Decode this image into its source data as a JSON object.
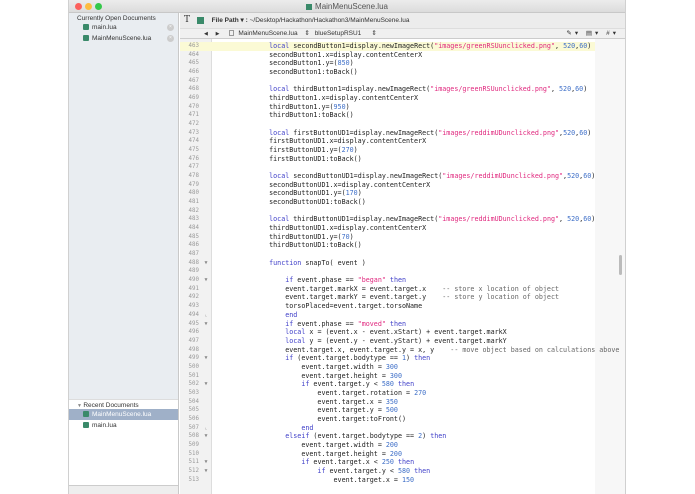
{
  "window": {
    "title": "MainMenuScene.lua"
  },
  "sidebar": {
    "open_header": "Currently Open Documents",
    "open_docs": [
      "main.lua",
      "MainMenuScene.lua"
    ],
    "recent_header": "Recent Documents",
    "recent_docs": [
      "MainMenuScene.lua",
      "main.lua"
    ]
  },
  "toolbar": {
    "file_path_label": "File Path ▾ :",
    "file_path": "~/Desktop/Hackathon/Hackathon3/MainMenuScene.lua"
  },
  "navbar": {
    "file": "MainMenuScene.lua",
    "symbol": "blueSetupRSU1"
  },
  "editor": {
    "highlight_line": 463,
    "lines": [
      {
        "n": 463,
        "f": "",
        "t": [
          [
            "",
            "    "
          ],
          [
            "kw",
            "local"
          ],
          [
            "",
            " secondButton1=display.newImageRect("
          ],
          [
            "str",
            "\"images/greenRSUunclicked.png\""
          ],
          [
            "",
            ", "
          ],
          [
            "num-lit",
            "520"
          ],
          [
            "",
            ","
          ],
          [
            "num-lit",
            "60"
          ],
          [
            "",
            ")"
          ]
        ]
      },
      {
        "n": 464,
        "f": "",
        "t": [
          [
            "",
            "    secondButton1.x=display.contentCenterX"
          ]
        ]
      },
      {
        "n": 465,
        "f": "",
        "t": [
          [
            "",
            "    secondButton1.y=("
          ],
          [
            "num-lit",
            "850"
          ],
          [
            "",
            ")"
          ]
        ]
      },
      {
        "n": 466,
        "f": "",
        "t": [
          [
            "",
            "    secondButton1:toBack()"
          ]
        ]
      },
      {
        "n": 467,
        "f": "",
        "t": []
      },
      {
        "n": 468,
        "f": "",
        "t": [
          [
            "",
            "    "
          ],
          [
            "kw",
            "local"
          ],
          [
            "",
            " thirdButton1=display.newImageRect("
          ],
          [
            "str",
            "\"images/greenRSUunclicked.png\""
          ],
          [
            "",
            ", "
          ],
          [
            "num-lit",
            "520"
          ],
          [
            "",
            ","
          ],
          [
            "num-lit",
            "60"
          ],
          [
            "",
            ")"
          ]
        ]
      },
      {
        "n": 469,
        "f": "",
        "t": [
          [
            "",
            "    thirdButton1.x=display.contentCenterX"
          ]
        ]
      },
      {
        "n": 470,
        "f": "",
        "t": [
          [
            "",
            "    thirdButton1.y=("
          ],
          [
            "num-lit",
            "950"
          ],
          [
            "",
            ")"
          ]
        ]
      },
      {
        "n": 471,
        "f": "",
        "t": [
          [
            "",
            "    thirdButton1:toBack()"
          ]
        ]
      },
      {
        "n": 472,
        "f": "",
        "t": []
      },
      {
        "n": 473,
        "f": "",
        "t": [
          [
            "",
            "    "
          ],
          [
            "kw",
            "local"
          ],
          [
            "",
            " firstButtonUD1=display.newImageRect("
          ],
          [
            "str",
            "\"images/reddimUDunclicked.png\""
          ],
          [
            "",
            ","
          ],
          [
            "num-lit",
            "520"
          ],
          [
            "",
            ","
          ],
          [
            "num-lit",
            "60"
          ],
          [
            "",
            ")"
          ]
        ]
      },
      {
        "n": 474,
        "f": "",
        "t": [
          [
            "",
            "    firstButtonUD1.x=display.contentCenterX"
          ]
        ]
      },
      {
        "n": 475,
        "f": "",
        "t": [
          [
            "",
            "    firstButtonUD1.y=("
          ],
          [
            "num-lit",
            "270"
          ],
          [
            "",
            ")"
          ]
        ]
      },
      {
        "n": 476,
        "f": "",
        "t": [
          [
            "",
            "    firstButtonUD1:toBack()"
          ]
        ]
      },
      {
        "n": 477,
        "f": "",
        "t": []
      },
      {
        "n": 478,
        "f": "",
        "t": [
          [
            "",
            "    "
          ],
          [
            "kw",
            "local"
          ],
          [
            "",
            " secondButtonUD1=display.newImageRect("
          ],
          [
            "str",
            "\"images/reddimUDunclicked.png\""
          ],
          [
            "",
            ","
          ],
          [
            "num-lit",
            "520"
          ],
          [
            "",
            ","
          ],
          [
            "num-lit",
            "60"
          ],
          [
            "",
            ")"
          ]
        ]
      },
      {
        "n": 479,
        "f": "",
        "t": [
          [
            "",
            "    secondButtonUD1.x=display.contentCenterX"
          ]
        ]
      },
      {
        "n": 480,
        "f": "",
        "t": [
          [
            "",
            "    secondButtonUD1.y=("
          ],
          [
            "num-lit",
            "170"
          ],
          [
            "",
            ")"
          ]
        ]
      },
      {
        "n": 481,
        "f": "",
        "t": [
          [
            "",
            "    secondButtonUD1:toBack()"
          ]
        ]
      },
      {
        "n": 482,
        "f": "",
        "t": []
      },
      {
        "n": 483,
        "f": "",
        "t": [
          [
            "",
            "    "
          ],
          [
            "kw",
            "local"
          ],
          [
            "",
            " thirdButtonUD1=display.newImageRect("
          ],
          [
            "str",
            "\"images/reddimUDunclicked.png\""
          ],
          [
            "",
            ", "
          ],
          [
            "num-lit",
            "520"
          ],
          [
            "",
            ","
          ],
          [
            "num-lit",
            "60"
          ],
          [
            "",
            ")"
          ]
        ]
      },
      {
        "n": 484,
        "f": "",
        "t": [
          [
            "",
            "    thirdButtonUD1.x=display.contentCenterX"
          ]
        ]
      },
      {
        "n": 485,
        "f": "",
        "t": [
          [
            "",
            "    thirdButtonUD1.y=("
          ],
          [
            "num-lit",
            "70"
          ],
          [
            "",
            ")"
          ]
        ]
      },
      {
        "n": 486,
        "f": "",
        "t": [
          [
            "",
            "    thirdButtonUD1:toBack()"
          ]
        ]
      },
      {
        "n": 487,
        "f": "",
        "t": []
      },
      {
        "n": 488,
        "f": "▼",
        "t": [
          [
            "",
            "    "
          ],
          [
            "kw",
            "function"
          ],
          [
            "",
            " snapTo( event )"
          ]
        ]
      },
      {
        "n": 489,
        "f": "",
        "t": []
      },
      {
        "n": 490,
        "f": "▼",
        "t": [
          [
            "",
            "        "
          ],
          [
            "kw",
            "if"
          ],
          [
            "",
            " event.phase == "
          ],
          [
            "str",
            "\"began\""
          ],
          [
            "",
            "",
            " "
          ],
          [
            "kw",
            " then"
          ]
        ]
      },
      {
        "n": 491,
        "f": "",
        "t": [
          [
            "",
            "        event.target.markX = event.target.x    "
          ],
          [
            "com",
            "-- store x location of object"
          ]
        ]
      },
      {
        "n": 492,
        "f": "",
        "t": [
          [
            "",
            "        event.target.markY = event.target.y    "
          ],
          [
            "com",
            "-- store y location of object"
          ]
        ]
      },
      {
        "n": 493,
        "f": "",
        "t": [
          [
            "",
            "        torsoPlaced=event.target.torsoName"
          ]
        ]
      },
      {
        "n": 494,
        "f": "⌞",
        "t": [
          [
            "",
            "        "
          ],
          [
            "kw",
            "end"
          ]
        ]
      },
      {
        "n": 495,
        "f": "▼",
        "t": [
          [
            "",
            "        "
          ],
          [
            "kw",
            "if"
          ],
          [
            "",
            " event.phase == "
          ],
          [
            "str",
            "\"moved\""
          ],
          [
            "kw",
            " then"
          ]
        ]
      },
      {
        "n": 496,
        "f": "",
        "t": [
          [
            "",
            "        "
          ],
          [
            "kw",
            "local"
          ],
          [
            "",
            " x = (event.x - event.xStart) + event.target.markX"
          ]
        ]
      },
      {
        "n": 497,
        "f": "",
        "t": [
          [
            "",
            "        "
          ],
          [
            "kw",
            "local"
          ],
          [
            "",
            " y = (event.y - event.yStart) + event.target.markY"
          ]
        ]
      },
      {
        "n": 498,
        "f": "",
        "t": [
          [
            "",
            "        event.target.x, event.target.y = x, y    "
          ],
          [
            "com",
            "-- move object based on calculations above"
          ]
        ]
      },
      {
        "n": 499,
        "f": "▼",
        "t": [
          [
            "",
            "        "
          ],
          [
            "kw",
            "if"
          ],
          [
            "",
            " (event.target.bodytype == "
          ],
          [
            "num-lit",
            "1"
          ],
          [
            "",
            ")"
          ],
          [
            "kw",
            " then"
          ]
        ]
      },
      {
        "n": 500,
        "f": "",
        "t": [
          [
            "",
            "            event.target.width = "
          ],
          [
            "num-lit",
            "300"
          ]
        ]
      },
      {
        "n": 501,
        "f": "",
        "t": [
          [
            "",
            "            event.target.height = "
          ],
          [
            "num-lit",
            "300"
          ]
        ]
      },
      {
        "n": 502,
        "f": "▼",
        "t": [
          [
            "",
            "            "
          ],
          [
            "kw",
            "if"
          ],
          [
            "",
            " event.target.y < "
          ],
          [
            "num-lit",
            "580"
          ],
          [
            "kw",
            " then"
          ]
        ]
      },
      {
        "n": 503,
        "f": "",
        "t": [
          [
            "",
            "                event.target.rotation = "
          ],
          [
            "num-lit",
            "270"
          ]
        ]
      },
      {
        "n": 504,
        "f": "",
        "t": [
          [
            "",
            "                event.target.x = "
          ],
          [
            "num-lit",
            "350"
          ]
        ]
      },
      {
        "n": 505,
        "f": "",
        "t": [
          [
            "",
            "                event.target.y = "
          ],
          [
            "num-lit",
            "500"
          ]
        ]
      },
      {
        "n": 506,
        "f": "",
        "t": [
          [
            "",
            "                event.target:toFront()"
          ]
        ]
      },
      {
        "n": 507,
        "f": "⌞",
        "t": [
          [
            "",
            "            "
          ],
          [
            "kw",
            "end"
          ]
        ]
      },
      {
        "n": 508,
        "f": "▼",
        "t": [
          [
            "",
            "        "
          ],
          [
            "kw",
            "elseif"
          ],
          [
            "",
            " (event.target.bodytype == "
          ],
          [
            "num-lit",
            "2"
          ],
          [
            "",
            ")"
          ],
          [
            "kw",
            " then"
          ]
        ]
      },
      {
        "n": 509,
        "f": "",
        "t": [
          [
            "",
            "            event.target.width = "
          ],
          [
            "num-lit",
            "200"
          ]
        ]
      },
      {
        "n": 510,
        "f": "",
        "t": [
          [
            "",
            "            event.target.height = "
          ],
          [
            "num-lit",
            "200"
          ]
        ]
      },
      {
        "n": 511,
        "f": "▼",
        "t": [
          [
            "",
            "            "
          ],
          [
            "kw",
            "if"
          ],
          [
            "",
            " event.target.x < "
          ],
          [
            "num-lit",
            "250"
          ],
          [
            "kw",
            " then"
          ]
        ]
      },
      {
        "n": 512,
        "f": "▼",
        "t": [
          [
            "",
            "                "
          ],
          [
            "kw",
            "if"
          ],
          [
            "",
            " event.target.y < "
          ],
          [
            "num-lit",
            "580"
          ],
          [
            "kw",
            " then"
          ]
        ]
      },
      {
        "n": 513,
        "f": "",
        "t": [
          [
            "",
            "                    event.target.x = "
          ],
          [
            "num-lit",
            "150"
          ]
        ]
      }
    ]
  }
}
